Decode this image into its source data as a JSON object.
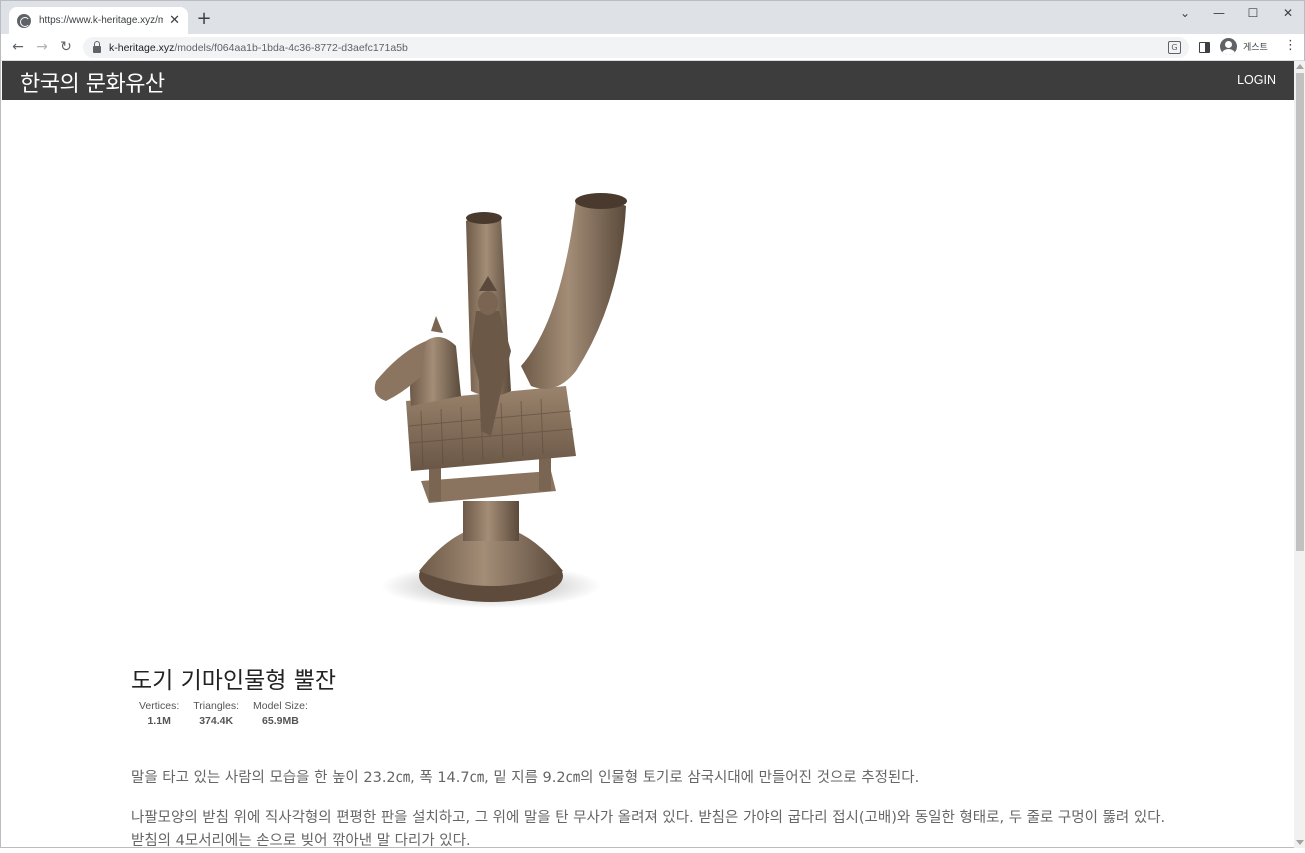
{
  "browser": {
    "tab_title": "https://www.k-heritage.xyz/mod",
    "url_host": "k-heritage.xyz",
    "url_path": "/models/f064aa1b-1bda-4c36-8772-d3aefc171a5b",
    "profile_name": "게스트"
  },
  "header": {
    "site_title": "한국의 문화유산",
    "login_label": "LOGIN"
  },
  "model": {
    "title": "도기 기마인물형 뿔잔",
    "stats": [
      {
        "label": "Vertices:",
        "value": "1.1M"
      },
      {
        "label": "Triangles:",
        "value": "374.4K"
      },
      {
        "label": "Model Size:",
        "value": "65.9MB"
      }
    ],
    "description": [
      "말을 타고 있는 사람의 모습을 한 높이 23.2㎝, 폭 14.7㎝, 밑 지름 9.2㎝의 인물형 토기로 삼국시대에 만들어진 것으로 추정된다.",
      "나팔모양의 받침 위에 직사각형의 편평한 판을 설치하고, 그 위에 말을 탄 무사가 올려져 있다. 받침은 가야의 굽다리 접시(고배)와 동일한 형태로, 두 줄로 구멍이 뚫려 있다. 받침의 4모서리에는 손으로 빚어 깎아낸 말 다리가 있다."
    ]
  },
  "icons": [
    "globe-icon",
    "close-icon",
    "plus-icon",
    "back-icon",
    "forward-icon",
    "reload-icon",
    "lock-icon",
    "translate-icon",
    "side-panel-icon",
    "avatar-icon",
    "more-icon"
  ]
}
